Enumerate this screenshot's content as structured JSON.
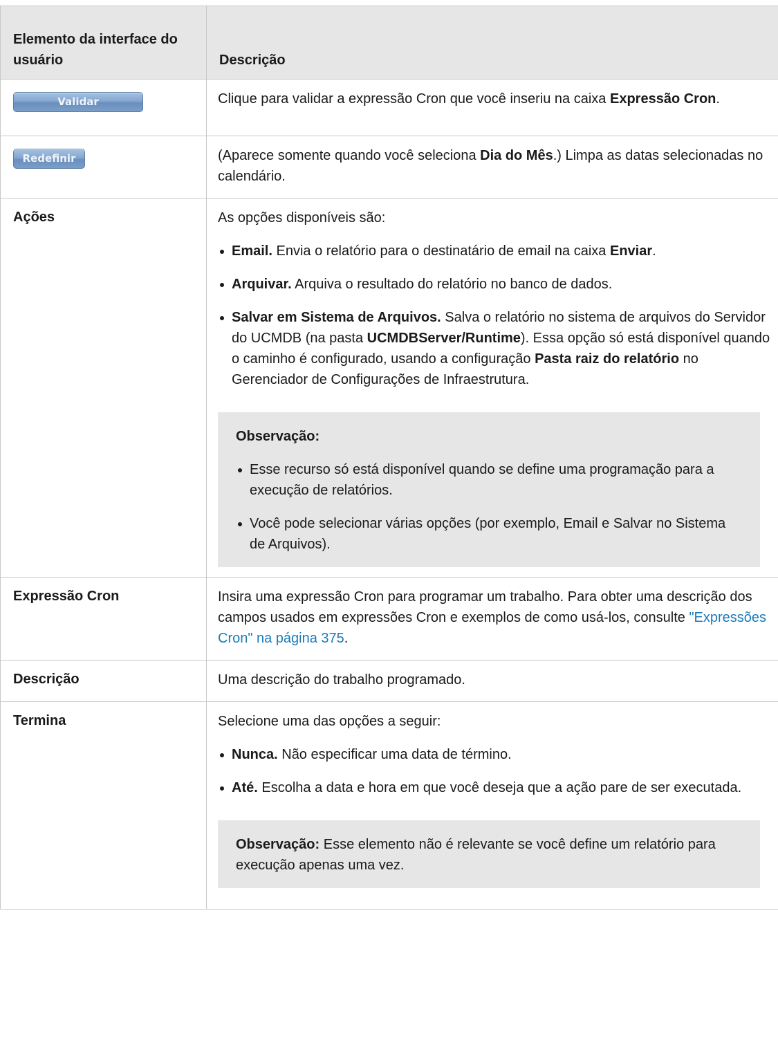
{
  "header": {
    "col1": "Elemento da interface do usuário",
    "col2": "Descrição"
  },
  "rows": {
    "validar": {
      "button_label": "Validar",
      "text1": "Clique para validar a expressão Cron que você inseriu na caixa ",
      "bold1": "Expressão Cron",
      "text2": "."
    },
    "redefinir": {
      "button_label": "Redefinir",
      "text1": "(Aparece somente quando você seleciona ",
      "bold1": "Dia do Mês",
      "text2": ".) Limpa as datas selecionadas no calendário."
    },
    "acoes": {
      "label": "Ações",
      "intro": "As opções disponíveis são:",
      "opt_email_bold": "Email.",
      "opt_email_text": " Envia o relatório para o destinatário de email na caixa ",
      "opt_email_bold2": "Enviar",
      "opt_email_end": ".",
      "opt_arquivar_bold": "Arquivar.",
      "opt_arquivar_text": " Arquiva o resultado do relatório no banco de dados.",
      "opt_salvar_bold": "Salvar em Sistema de Arquivos.",
      "opt_salvar_text1": " Salva o relatório no sistema de arquivos do Servidor do UCMDB (na pasta ",
      "opt_salvar_bold2": "UCMDBServer/Runtime",
      "opt_salvar_text2": "). Essa opção só está disponível quando o caminho é configurado, usando a configuração ",
      "opt_salvar_bold3": "Pasta raiz do relatório",
      "opt_salvar_text3": " no Gerenciador de Configurações de Infraestrutura.",
      "note_title": "Observação:",
      "note_item1": "Esse recurso só está disponível quando se define uma programação para a execução de relatórios.",
      "note_item2": "Você pode selecionar várias opções (por exemplo, Email e Salvar no Sistema de Arquivos)."
    },
    "cron": {
      "label": "Expressão Cron",
      "text1": "Insira uma expressão Cron para programar um trabalho. Para obter uma descrição dos campos usados em expressões Cron e exemplos de como usá-los, consulte ",
      "link": "\"Expressões Cron\" na página 375",
      "text2": "."
    },
    "descricao": {
      "label": "Descrição",
      "text": "Uma descrição do trabalho programado."
    },
    "termina": {
      "label": "Termina",
      "intro": "Selecione uma das opções a seguir:",
      "opt_nunca_bold": "Nunca.",
      "opt_nunca_text": " Não especificar uma data de término.",
      "opt_ate_bold": "Até.",
      "opt_ate_text": " Escolha a data e hora em que você deseja que a ação pare de ser executada.",
      "note_bold": "Observação:",
      "note_text": " Esse elemento não é relevante se você define um relatório para execução apenas uma vez."
    }
  }
}
